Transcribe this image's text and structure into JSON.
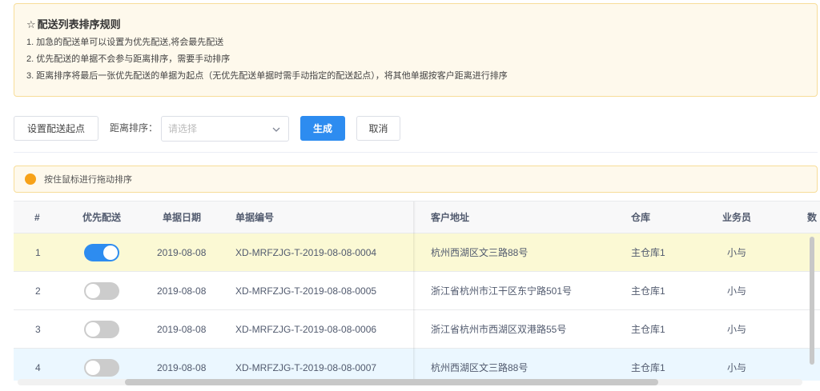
{
  "notice": {
    "star": "☆",
    "title": "配送列表排序规则",
    "lines": [
      "1. 加急的配送单可以设置为优先配送,将会最先配送",
      "2. 优先配送的单据不会参与距离排序，需要手动排序",
      "3. 距离排序将最后一张优先配送的单据为起点（无优先配送单据时需手动指定的配送起点），将其他单据按客户距离进行排序"
    ]
  },
  "toolbar": {
    "set_start_label": "设置配送起点",
    "sort_label": "距离排序：",
    "select_placeholder": "请选择",
    "generate_label": "生成",
    "cancel_label": "取消"
  },
  "tip": {
    "text": "按住鼠标进行拖动排序",
    "dot_color": "#f7a218"
  },
  "table": {
    "headers": {
      "index": "#",
      "priority": "优先配送",
      "date": "单据日期",
      "number": "单据编号",
      "address": "客户地址",
      "warehouse": "仓库",
      "salesman": "业务员",
      "quantity": "数"
    },
    "rows": [
      {
        "index": "1",
        "priority": true,
        "date": "2019-08-08",
        "number": "XD-MRFZJG-T-2019-08-08-0004",
        "address": "杭州西湖区文三路88号",
        "warehouse": "主仓库1",
        "salesman": "小与"
      },
      {
        "index": "2",
        "priority": false,
        "date": "2019-08-08",
        "number": "XD-MRFZJG-T-2019-08-08-0005",
        "address": "浙江省杭州市江干区东宁路501号",
        "warehouse": "主仓库1",
        "salesman": "小与"
      },
      {
        "index": "3",
        "priority": false,
        "date": "2019-08-08",
        "number": "XD-MRFZJG-T-2019-08-08-0006",
        "address": "浙江省杭州市西湖区双港路55号",
        "warehouse": "主仓库1",
        "salesman": "小与"
      },
      {
        "index": "4",
        "priority": false,
        "date": "2019-08-08",
        "number": "XD-MRFZJG-T-2019-08-08-0007",
        "address": "杭州西湖区文三路88号",
        "warehouse": "主仓库1",
        "salesman": "小与"
      }
    ]
  },
  "colors": {
    "primary": "#2d8cf0",
    "notice_bg": "#fef9ec",
    "highlight_row": "#fbf9d4",
    "hover_row": "#ebf7ff"
  }
}
